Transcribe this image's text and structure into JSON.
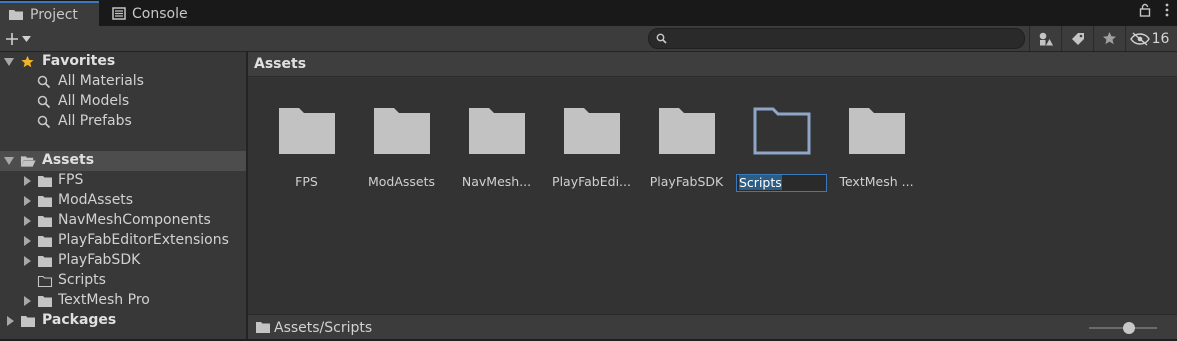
{
  "tabs": {
    "project": "Project",
    "console": "Console"
  },
  "toolbar": {
    "search_placeholder": "",
    "hidden_count": "16"
  },
  "tree": {
    "favorites_label": "Favorites",
    "favorites": [
      "All Materials",
      "All Models",
      "All Prefabs"
    ],
    "assets_label": "Assets",
    "assets": [
      "FPS",
      "ModAssets",
      "NavMeshComponents",
      "PlayFabEditorExtensions",
      "PlayFabSDK",
      "Scripts",
      "TextMesh Pro"
    ],
    "packages_label": "Packages"
  },
  "content": {
    "header": "Assets",
    "items": [
      "FPS",
      "ModAssets",
      "NavMesh...",
      "PlayFabEdi...",
      "PlayFabSDK",
      "Scripts",
      "TextMesh ..."
    ],
    "editing_item": "Scripts"
  },
  "status": {
    "path": "Assets/Scripts",
    "zoom_fraction": 0.6
  }
}
